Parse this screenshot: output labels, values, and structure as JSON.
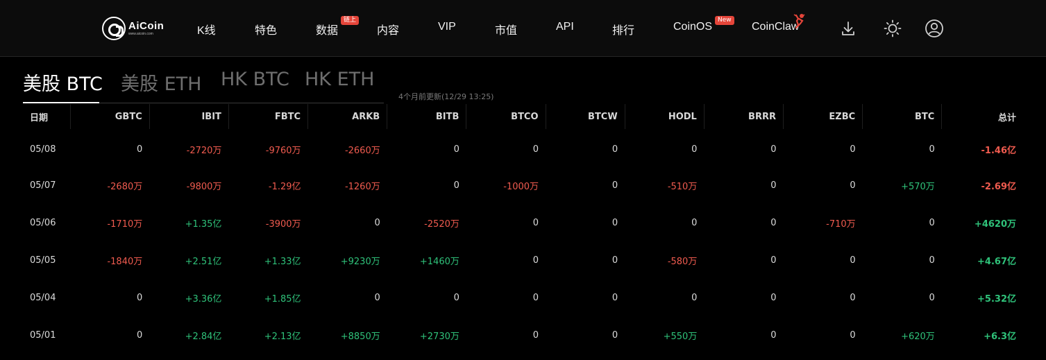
{
  "nav": {
    "logo_name": "AiCoin",
    "logo_url": "www.aicoin.com",
    "items": [
      {
        "label": "K线"
      },
      {
        "label": "特色"
      },
      {
        "label": "数据",
        "badge": "链上"
      },
      {
        "label": "内容"
      },
      {
        "label": "VIP"
      },
      {
        "label": "市值"
      },
      {
        "label": "API"
      },
      {
        "label": "排行"
      },
      {
        "label": "CoinOS",
        "badge": "New"
      },
      {
        "label": "CoinClaw"
      }
    ],
    "icons": [
      "download-icon",
      "theme-sun-icon",
      "user-icon"
    ]
  },
  "tabs": [
    {
      "label": "美股 BTC",
      "active": true
    },
    {
      "label": "美股 ETH",
      "active": false
    },
    {
      "label": "HK BTC",
      "active": false
    },
    {
      "label": "HK ETH",
      "active": false
    }
  ],
  "updated_text": "4个月前更新(12/29 13:25)",
  "colors": {
    "positive": "#2fc27a",
    "negative": "#f05b4f",
    "background": "#000000",
    "badge": "#e5453a"
  },
  "table": {
    "columns": [
      "日期",
      "GBTC",
      "IBIT",
      "FBTC",
      "ARKB",
      "BITB",
      "BTCO",
      "BTCW",
      "HODL",
      "BRRR",
      "EZBC",
      "BTC",
      "总计"
    ],
    "rows": [
      [
        "05/08",
        "0",
        "-2720万",
        "-9760万",
        "-2660万",
        "0",
        "0",
        "0",
        "0",
        "0",
        "0",
        "0",
        "-1.46亿"
      ],
      [
        "05/07",
        "-2680万",
        "-9800万",
        "-1.29亿",
        "-1260万",
        "0",
        "-1000万",
        "0",
        "-510万",
        "0",
        "0",
        "+570万",
        "-2.69亿"
      ],
      [
        "05/06",
        "-1710万",
        "+1.35亿",
        "-3900万",
        "0",
        "-2520万",
        "0",
        "0",
        "0",
        "0",
        "-710万",
        "0",
        "+4620万"
      ],
      [
        "05/05",
        "-1840万",
        "+2.51亿",
        "+1.33亿",
        "+9230万",
        "+1460万",
        "0",
        "0",
        "-580万",
        "0",
        "0",
        "0",
        "+4.67亿"
      ],
      [
        "05/04",
        "0",
        "+3.36亿",
        "+1.85亿",
        "0",
        "0",
        "0",
        "0",
        "0",
        "0",
        "0",
        "0",
        "+5.32亿"
      ],
      [
        "05/01",
        "0",
        "+2.84亿",
        "+2.13亿",
        "+8850万",
        "+2730万",
        "0",
        "0",
        "+550万",
        "0",
        "0",
        "+620万",
        "+6.3亿"
      ]
    ]
  }
}
